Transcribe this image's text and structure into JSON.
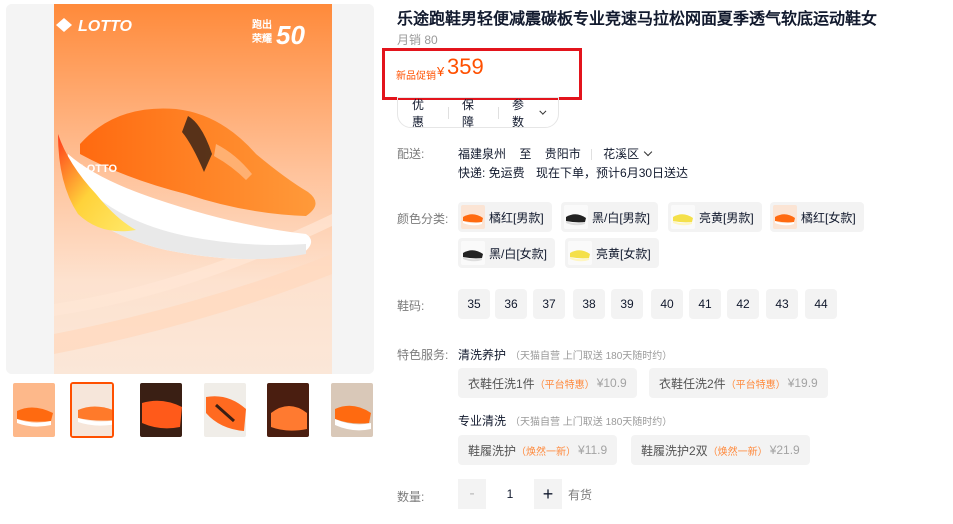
{
  "product": {
    "title": "乐途跑鞋男轻便减震碳板专业竞速马拉松网面夏季透气软底运动鞋女",
    "sales": "月销 80",
    "price_label": "新品促销",
    "currency": "¥",
    "price": "359"
  },
  "tabs": [
    {
      "label": "优惠"
    },
    {
      "label": "保障"
    },
    {
      "label": "参数"
    }
  ],
  "shipping": {
    "label": "配送:",
    "from": "福建泉州",
    "to_word": "至",
    "city": "贵阳市",
    "district": "花溪区",
    "express": "快递: 免运费",
    "eta": "现在下单，预计6月30日送达"
  },
  "color": {
    "label": "颜色分类:",
    "options": [
      {
        "label": "橘红[男款]",
        "swatch": "orange"
      },
      {
        "label": "黑/白[男款]",
        "swatch": "black"
      },
      {
        "label": "亮黄[男款]",
        "swatch": "yellow"
      },
      {
        "label": "橘红[女款]",
        "swatch": "orange"
      },
      {
        "label": "黑/白[女款]",
        "swatch": "black"
      },
      {
        "label": "亮黄[女款]",
        "swatch": "yellow"
      }
    ]
  },
  "size": {
    "label": "鞋码:",
    "options": [
      "35",
      "36",
      "37",
      "38",
      "39",
      "40",
      "41",
      "42",
      "43",
      "44"
    ]
  },
  "services": {
    "label": "特色服务:",
    "groups": [
      {
        "title": "清洗养护",
        "note": "（天猫自营 上门取送 180天随时约）",
        "items": [
          {
            "name": "衣鞋任洗1件",
            "promo": "（平台特惠）",
            "price": "¥10.9"
          },
          {
            "name": "衣鞋任洗2件",
            "promo": "（平台特惠）",
            "price": "¥19.9"
          }
        ]
      },
      {
        "title": "专业清洗",
        "note": "（天猫自营 上门取送 180天随时约）",
        "items": [
          {
            "name": "鞋履洗护",
            "promo": "（焕然一新）",
            "price": "¥11.9"
          },
          {
            "name": "鞋履洗护2双",
            "promo": "（焕然一新）",
            "price": "¥21.9"
          }
        ]
      }
    ]
  },
  "quantity": {
    "label": "数量:",
    "minus": "-",
    "value": "1",
    "plus": "+",
    "stock": "有货"
  },
  "image": {
    "brand": "LOTTO",
    "badge_line1": "跑出",
    "badge_line2": "荣耀",
    "badge_num": "50",
    "sole_text": "LOTTO"
  },
  "colors": {
    "accent": "#ff5000",
    "highlight_border": "#e3141c"
  }
}
